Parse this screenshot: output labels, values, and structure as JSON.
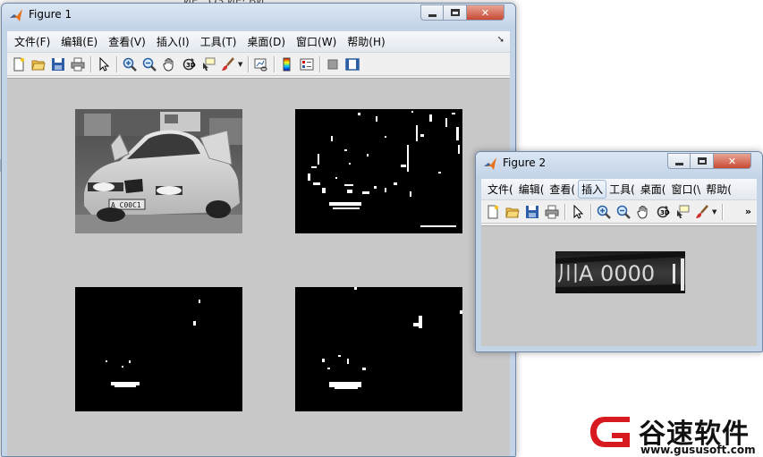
{
  "background": {
    "window_text": "ИЕ...ОЗ ИЕ· ВИ..."
  },
  "figure1": {
    "title": "Figure 1",
    "menu": [
      "文件(F)",
      "编辑(E)",
      "查看(V)",
      "插入(I)",
      "工具(T)",
      "桌面(D)",
      "窗口(W)",
      "帮助(H)"
    ],
    "panels": [
      {
        "content": "grayscale car photo",
        "plate_text": "A C00C1"
      },
      {
        "content": "edge-detected binary image"
      },
      {
        "content": "eroded binary image"
      },
      {
        "content": "morphologically processed binary image"
      }
    ]
  },
  "figure2": {
    "title": "Figure 2",
    "menu": [
      "文件(",
      "编辑(",
      "查看(",
      "插入",
      "工具(",
      "桌面(",
      "窗口(\\",
      "帮助("
    ],
    "highlighted_menu": "插入",
    "plate_text": "川A 0000"
  },
  "watermark": {
    "name": "谷速软件",
    "url": "www.gususoft.com"
  },
  "colors": {
    "canvas": "#c8c8c8",
    "title_bar": "#c4d5e9",
    "close_button": "#c74a34",
    "watermark_red": "#d71920"
  }
}
